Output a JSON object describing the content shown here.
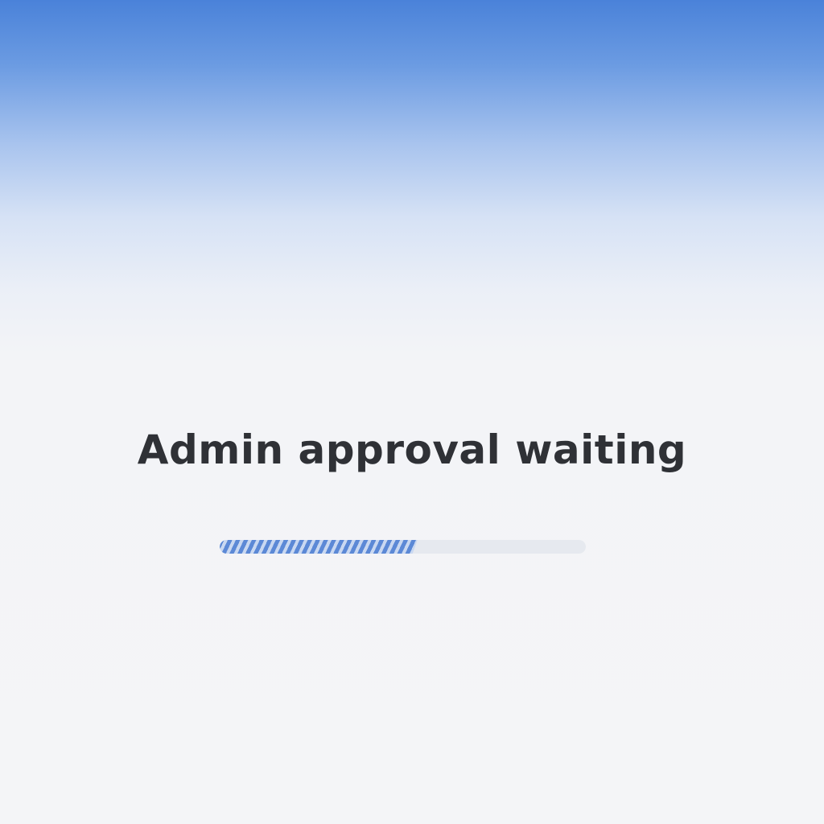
{
  "status": {
    "title": "Admin approval waiting"
  },
  "progress": {
    "percent": 54,
    "accent_color": "#5c89d6",
    "track_color": "#e6e9ef"
  },
  "background": {
    "top_color": "#4a82d9",
    "bottom_color": "#f4f5f7"
  }
}
